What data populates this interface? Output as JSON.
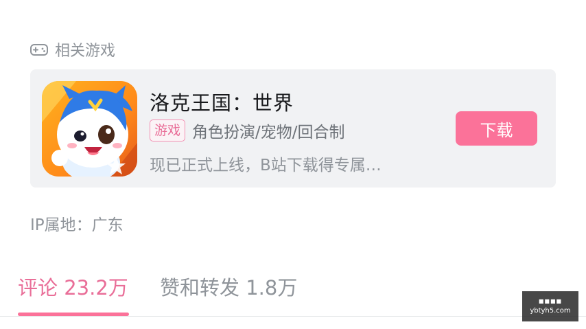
{
  "section": {
    "title": "相关游戏",
    "icon": "gamepad-icon"
  },
  "game": {
    "title": "洛克王国：世界",
    "tag": "游戏",
    "genres": "角色扮演/宠物/回合制",
    "description": "现已正式上线，B站下载得专属…",
    "download_label": "下载",
    "icon": "roco-kingdom-app-icon"
  },
  "ip_location": "IP属地：广东",
  "tabs": [
    {
      "label": "评论 23.2万",
      "active": true
    },
    {
      "label": "赞和转发 1.8万",
      "active": false
    }
  ],
  "watermark": {
    "top": "■■■■",
    "site": "ybtyh5.com"
  },
  "colors": {
    "accent": "#fb7299",
    "accent_text": "#e96e98",
    "muted_text": "#8f949a",
    "card_bg": "#f1f2f4"
  }
}
